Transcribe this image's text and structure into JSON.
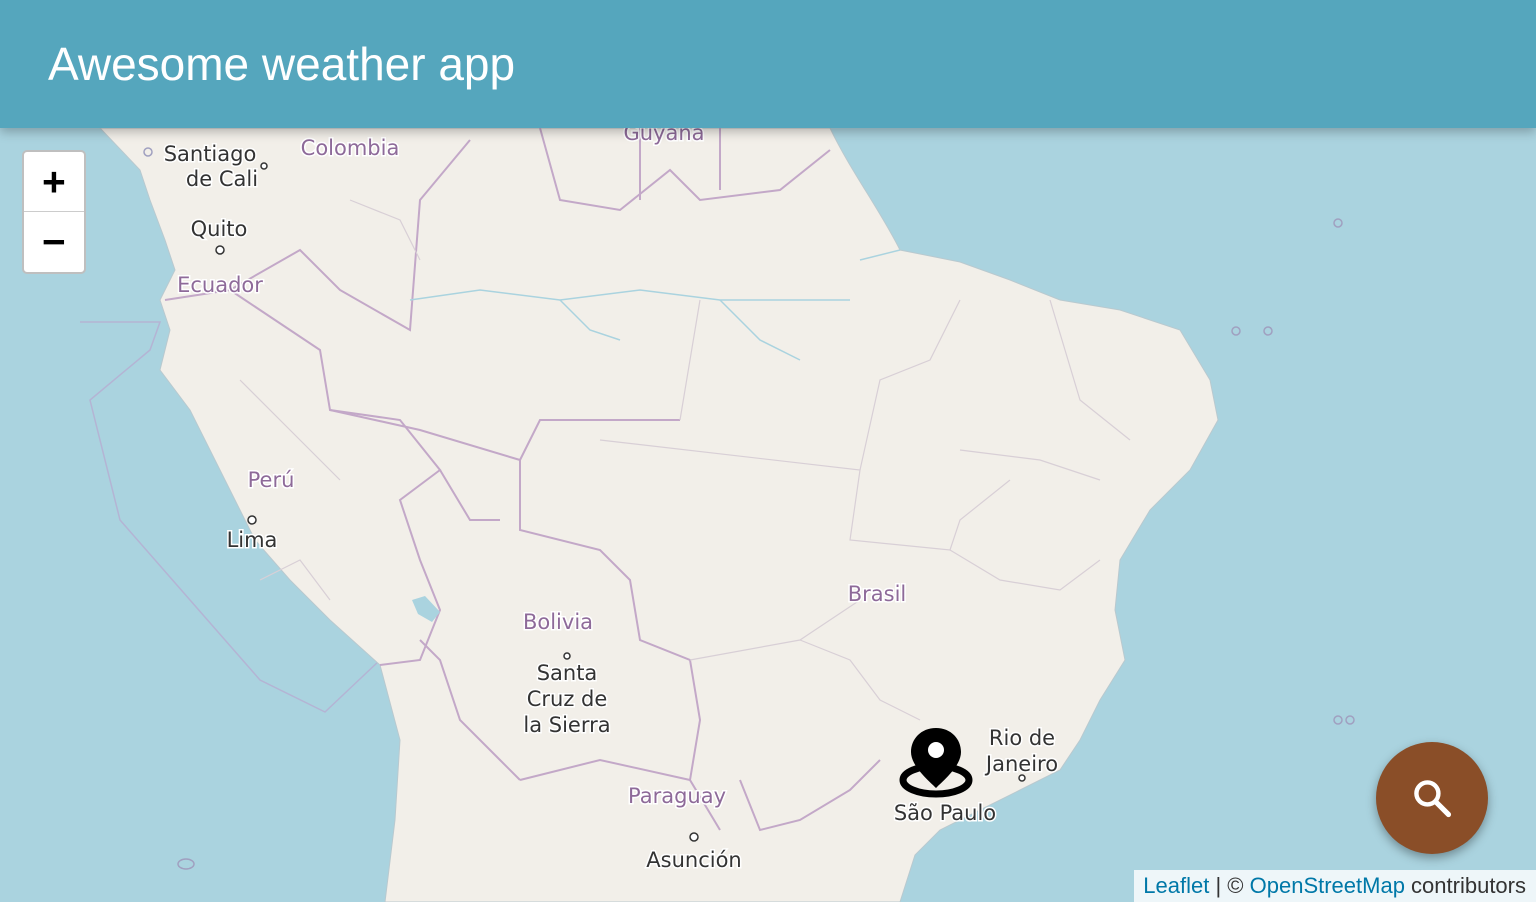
{
  "header": {
    "title": "Awesome weather app"
  },
  "zoom": {
    "in_label": "+",
    "out_label": "−"
  },
  "map": {
    "country_labels": {
      "colombia": "Colombia",
      "guyana": "Guyana",
      "ecuador": "Ecuador",
      "peru": "Perú",
      "bolivia": "Bolivia",
      "brasil": "Brasil",
      "paraguay": "Paraguay"
    },
    "city_labels": {
      "santiago_de_cali_1": "Santiago",
      "santiago_de_cali_2": "de Cali",
      "quito": "Quito",
      "lima": "Lima",
      "santa_cruz_1": "Santa",
      "santa_cruz_2": "Cruz de",
      "santa_cruz_3": "la Sierra",
      "rio_1": "Rio de",
      "rio_2": "Janeiro",
      "sao_paulo": "São Paulo",
      "asuncion": "Asunción"
    },
    "colors": {
      "water": "#aad3df",
      "land": "#f2efe9",
      "border": "#c3a8c8",
      "country_label": "#8e6a99",
      "city_label": "#333333"
    }
  },
  "marker": {
    "icon": "map-pin-icon"
  },
  "search_button": {
    "icon": "search-icon",
    "color": "#8a4e28"
  },
  "attribution": {
    "leaflet": "Leaflet",
    "separator": " | © ",
    "osm": "OpenStreetMap",
    "suffix": " contributors"
  },
  "colors": {
    "header": "#55a6bd",
    "header_text": "#ffffff"
  }
}
